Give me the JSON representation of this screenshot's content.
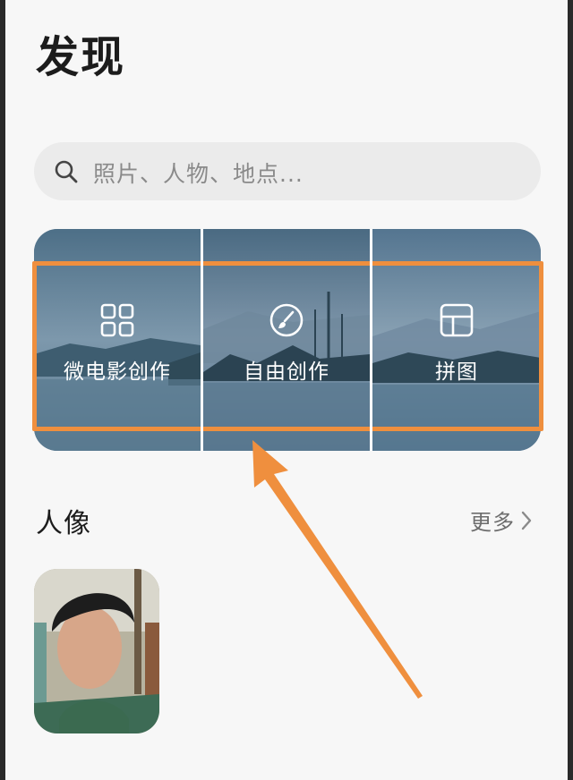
{
  "header": {
    "title": "发现"
  },
  "search": {
    "placeholder": "照片、人物、地点..."
  },
  "tiles": [
    {
      "label": "微电影创作",
      "icon": "grid-icon"
    },
    {
      "label": "自由创作",
      "icon": "brush-icon"
    },
    {
      "label": "拼图",
      "icon": "collage-icon"
    }
  ],
  "portraits_section": {
    "title": "人像",
    "more_label": "更多"
  },
  "colors": {
    "annotation": "#ef8f3e",
    "banner": "#6d8aa0"
  }
}
